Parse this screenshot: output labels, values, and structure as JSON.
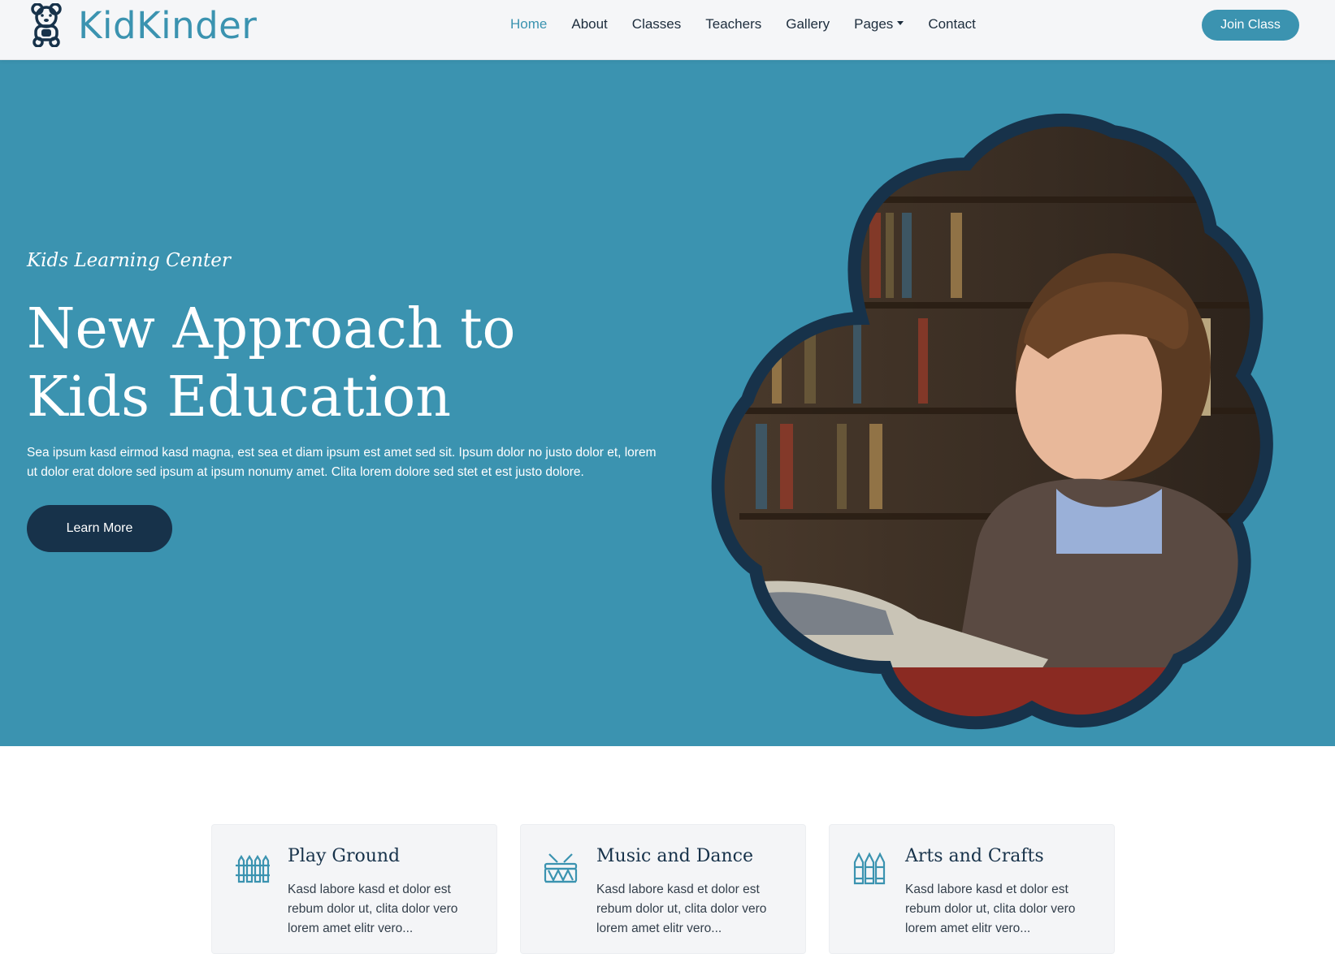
{
  "brand": {
    "name": "KidKinder",
    "logo_icon": "teddy-bear-icon"
  },
  "nav": {
    "items": [
      {
        "label": "Home",
        "active": true
      },
      {
        "label": "About"
      },
      {
        "label": "Classes"
      },
      {
        "label": "Teachers"
      },
      {
        "label": "Gallery"
      },
      {
        "label": "Pages",
        "dropdown": true
      },
      {
        "label": "Contact"
      }
    ],
    "cta_label": "Join Class"
  },
  "hero": {
    "subtitle": "Kids Learning Center",
    "title": "New Approach to Kids Education",
    "text": "Sea ipsum kasd eirmod kasd magna, est sea et diam ipsum est amet sed sit. Ipsum dolor no justo dolor et, lorem ut dolor erat dolore sed ipsum at ipsum nonumy amet. Clita lorem dolore sed stet et est justo dolore.",
    "button_label": "Learn More",
    "image": "boy-reading-book-in-library-photo"
  },
  "features": [
    {
      "icon": "fence-icon",
      "title": "Play Ground",
      "text": "Kasd labore kasd et dolor est rebum dolor ut, clita dolor vero lorem amet elitr vero..."
    },
    {
      "icon": "drum-icon",
      "title": "Music and Dance",
      "text": "Kasd labore kasd et dolor est rebum dolor ut, clita dolor vero lorem amet elitr vero..."
    },
    {
      "icon": "crayons-icon",
      "title": "Arts and Crafts",
      "text": "Kasd labore kasd et dolor est rebum dolor ut, clita dolor vero lorem amet elitr vero..."
    }
  ],
  "colors": {
    "primary": "#3b93b0",
    "dark": "#17324a",
    "navbar_bg": "#f5f6f8",
    "card_bg": "#f4f5f7"
  }
}
